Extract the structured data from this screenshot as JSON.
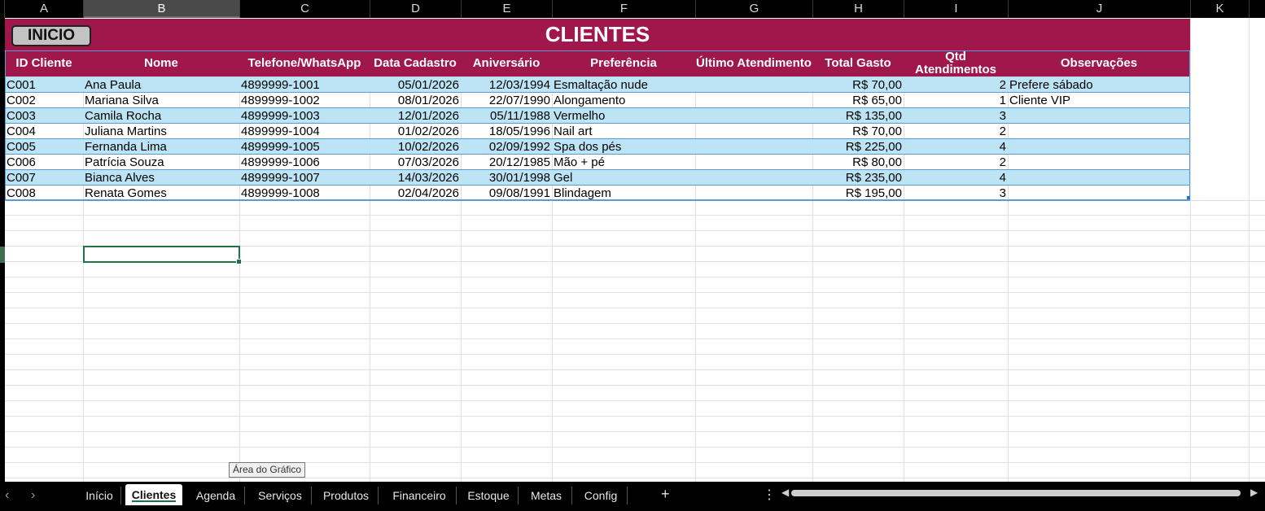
{
  "columns": [
    "A",
    "B",
    "C",
    "D",
    "E",
    "F",
    "G",
    "H",
    "I",
    "J",
    "K"
  ],
  "selected_column": "B",
  "sheet_title": "CLIENTES",
  "inicio_button": "INICIO",
  "headers": [
    "ID Cliente",
    "Nome",
    "Telefone/WhatsApp",
    "Data Cadastro",
    "Aniversário",
    "Preferência",
    "Último Atendimento",
    "Total Gasto",
    "Qtd Atendimentos",
    "Observações"
  ],
  "rows": [
    {
      "id": "C001",
      "nome": "Ana Paula",
      "telefone": "4899999-1001",
      "cadastro": "05/01/2026",
      "aniversario": "12/03/1994",
      "preferencia": "Esmaltação nude",
      "ultimo": "",
      "total": "R$ 70,00",
      "qtd": "2",
      "obs": "Prefere sábado"
    },
    {
      "id": "C002",
      "nome": "Mariana Silva",
      "telefone": "4899999-1002",
      "cadastro": "08/01/2026",
      "aniversario": "22/07/1990",
      "preferencia": "Alongamento",
      "ultimo": "",
      "total": "R$ 65,00",
      "qtd": "1",
      "obs": "Cliente VIP"
    },
    {
      "id": "C003",
      "nome": "Camila Rocha",
      "telefone": "4899999-1003",
      "cadastro": "12/01/2026",
      "aniversario": "05/11/1988",
      "preferencia": "Vermelho",
      "ultimo": "",
      "total": "R$ 135,00",
      "qtd": "3",
      "obs": ""
    },
    {
      "id": "C004",
      "nome": "Juliana Martins",
      "telefone": "4899999-1004",
      "cadastro": "01/02/2026",
      "aniversario": "18/05/1996",
      "preferencia": "Nail art",
      "ultimo": "",
      "total": "R$ 70,00",
      "qtd": "2",
      "obs": ""
    },
    {
      "id": "C005",
      "nome": "Fernanda Lima",
      "telefone": "4899999-1005",
      "cadastro": "10/02/2026",
      "aniversario": "02/09/1992",
      "preferencia": "Spa dos pés",
      "ultimo": "",
      "total": "R$ 225,00",
      "qtd": "4",
      "obs": ""
    },
    {
      "id": "C006",
      "nome": "Patrícia Souza",
      "telefone": "4899999-1006",
      "cadastro": "07/03/2026",
      "aniversario": "20/12/1985",
      "preferencia": "Mão + pé",
      "ultimo": "",
      "total": "R$ 80,00",
      "qtd": "2",
      "obs": ""
    },
    {
      "id": "C007",
      "nome": "Bianca Alves",
      "telefone": "4899999-1007",
      "cadastro": "14/03/2026",
      "aniversario": "30/01/1998",
      "preferencia": "Gel",
      "ultimo": "",
      "total": "R$ 235,00",
      "qtd": "4",
      "obs": ""
    },
    {
      "id": "C008",
      "nome": "Renata Gomes",
      "telefone": "4899999-1008",
      "cadastro": "02/04/2026",
      "aniversario": "09/08/1991",
      "preferencia": "Blindagem",
      "ultimo": "",
      "total": "R$ 195,00",
      "qtd": "3",
      "obs": ""
    }
  ],
  "tooltip": "Área do Gráfico",
  "sheet_tabs": [
    "Início",
    "Clientes",
    "Agenda",
    "Serviços",
    "Produtos",
    "Financeiro",
    "Estoque",
    "Metas",
    "Config"
  ],
  "active_tab": "Clientes",
  "colors": {
    "header_bg": "#a0174c",
    "band": "#bde4f5",
    "table_border": "#5b9bd5",
    "selection": "#217346"
  },
  "icons": {
    "prev": "chevron-left-icon",
    "next": "chevron-right-icon",
    "add": "plus-icon",
    "more": "kebab-icon"
  }
}
